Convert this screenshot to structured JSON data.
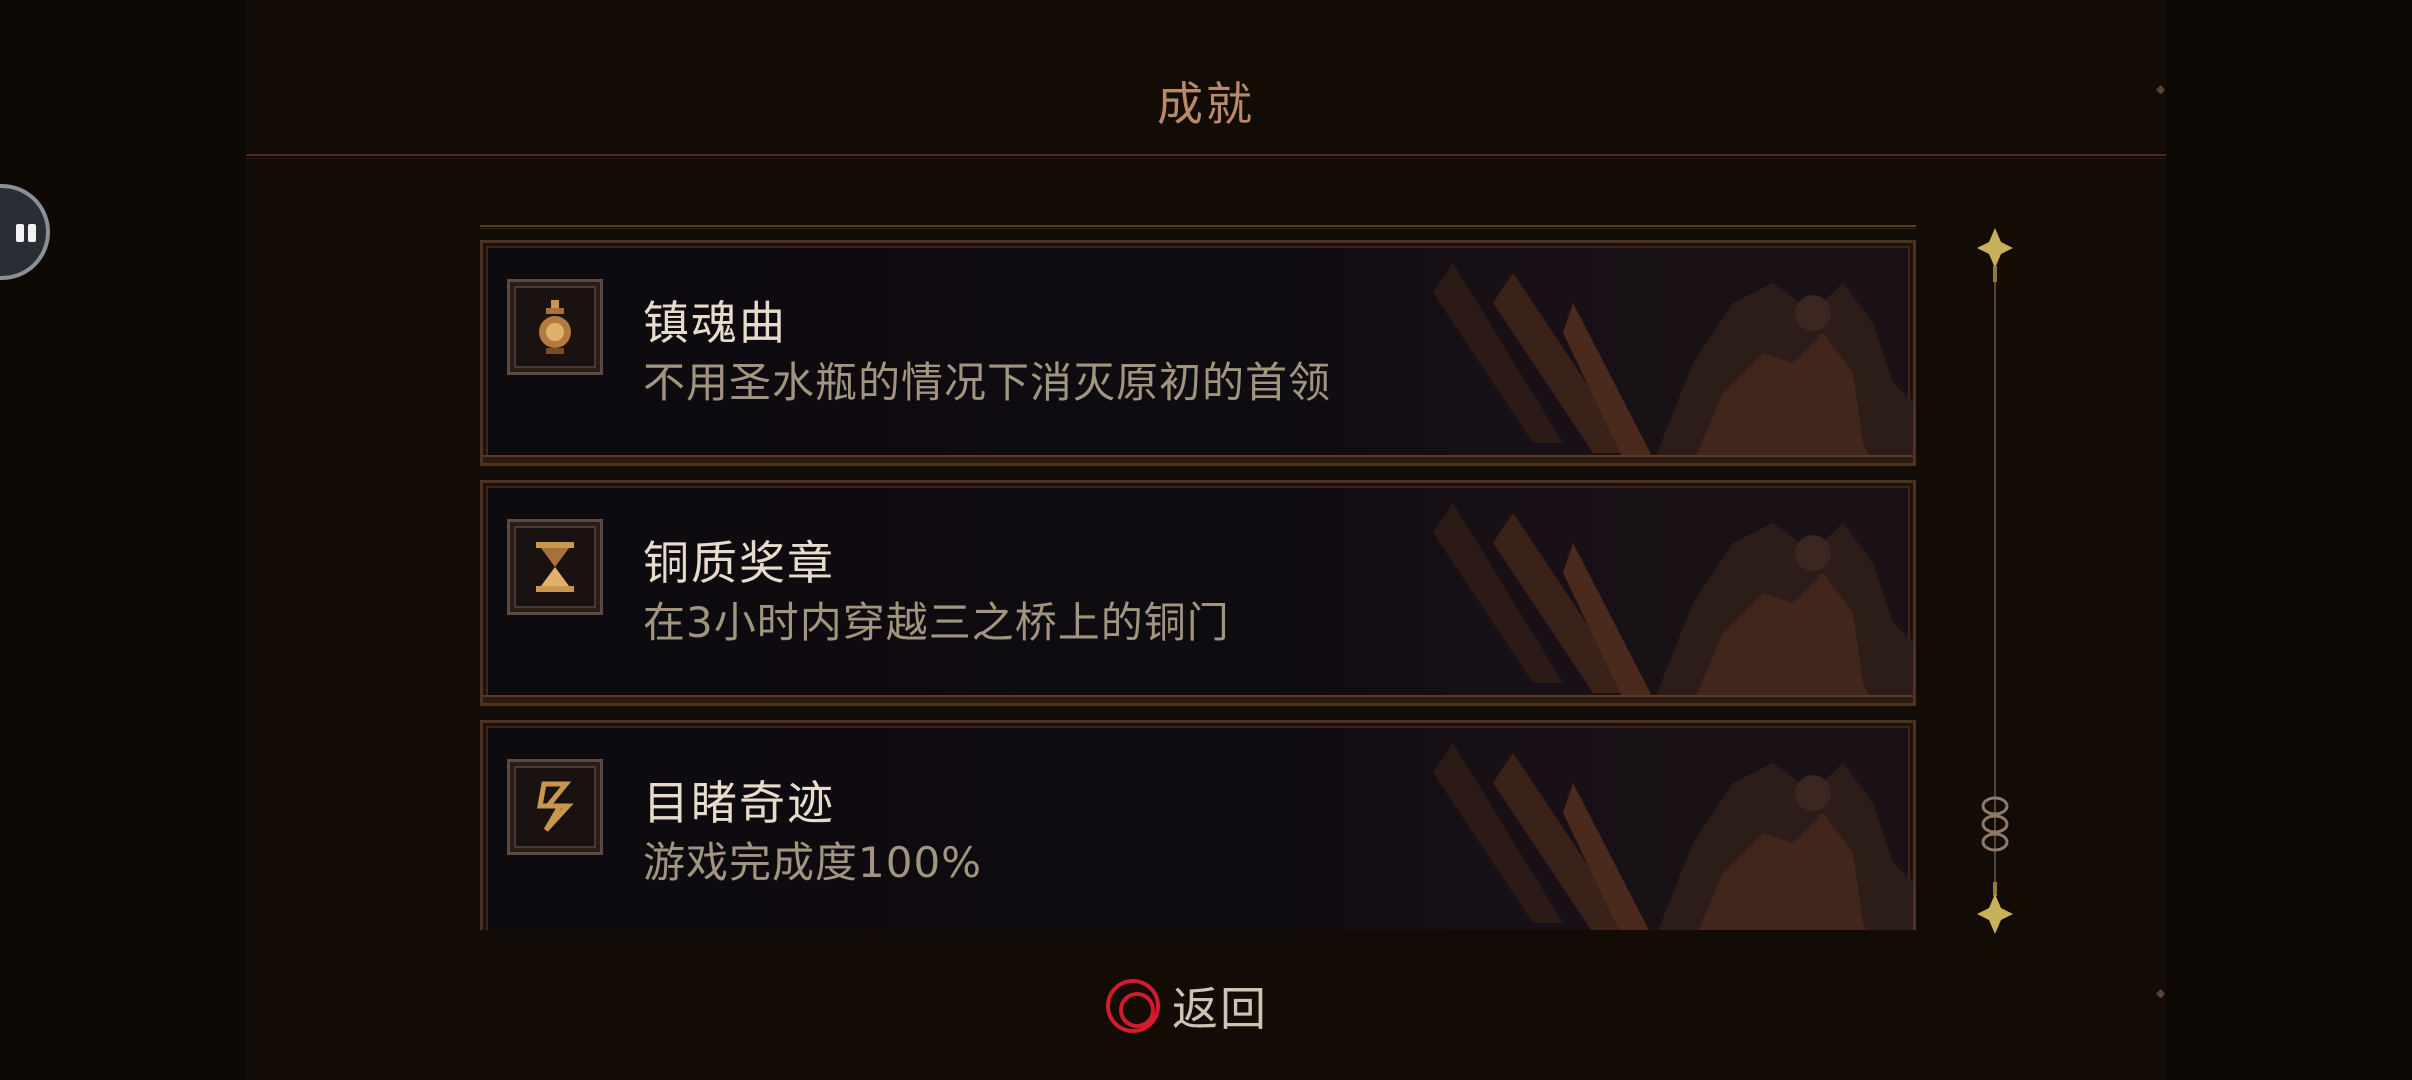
{
  "screen": {
    "title": "成就",
    "back_label": "返回",
    "back_icon": "circle-button-icon"
  },
  "achievements": [
    {
      "name": "镇魂曲",
      "description": "不用圣水瓶的情况下消灭原初的首领",
      "icon": "flask-icon"
    },
    {
      "name": "铜质奖章",
      "description": "在3小时内穿越三之桥上的铜门",
      "icon": "hourglass-icon"
    },
    {
      "name": "目睹奇迹",
      "description": "游戏完成度100%",
      "icon": "chain-rune-icon"
    }
  ],
  "colors": {
    "accent_red": "#d21c2e",
    "title_color": "#b98a6a",
    "gold": "#c9b15a"
  }
}
